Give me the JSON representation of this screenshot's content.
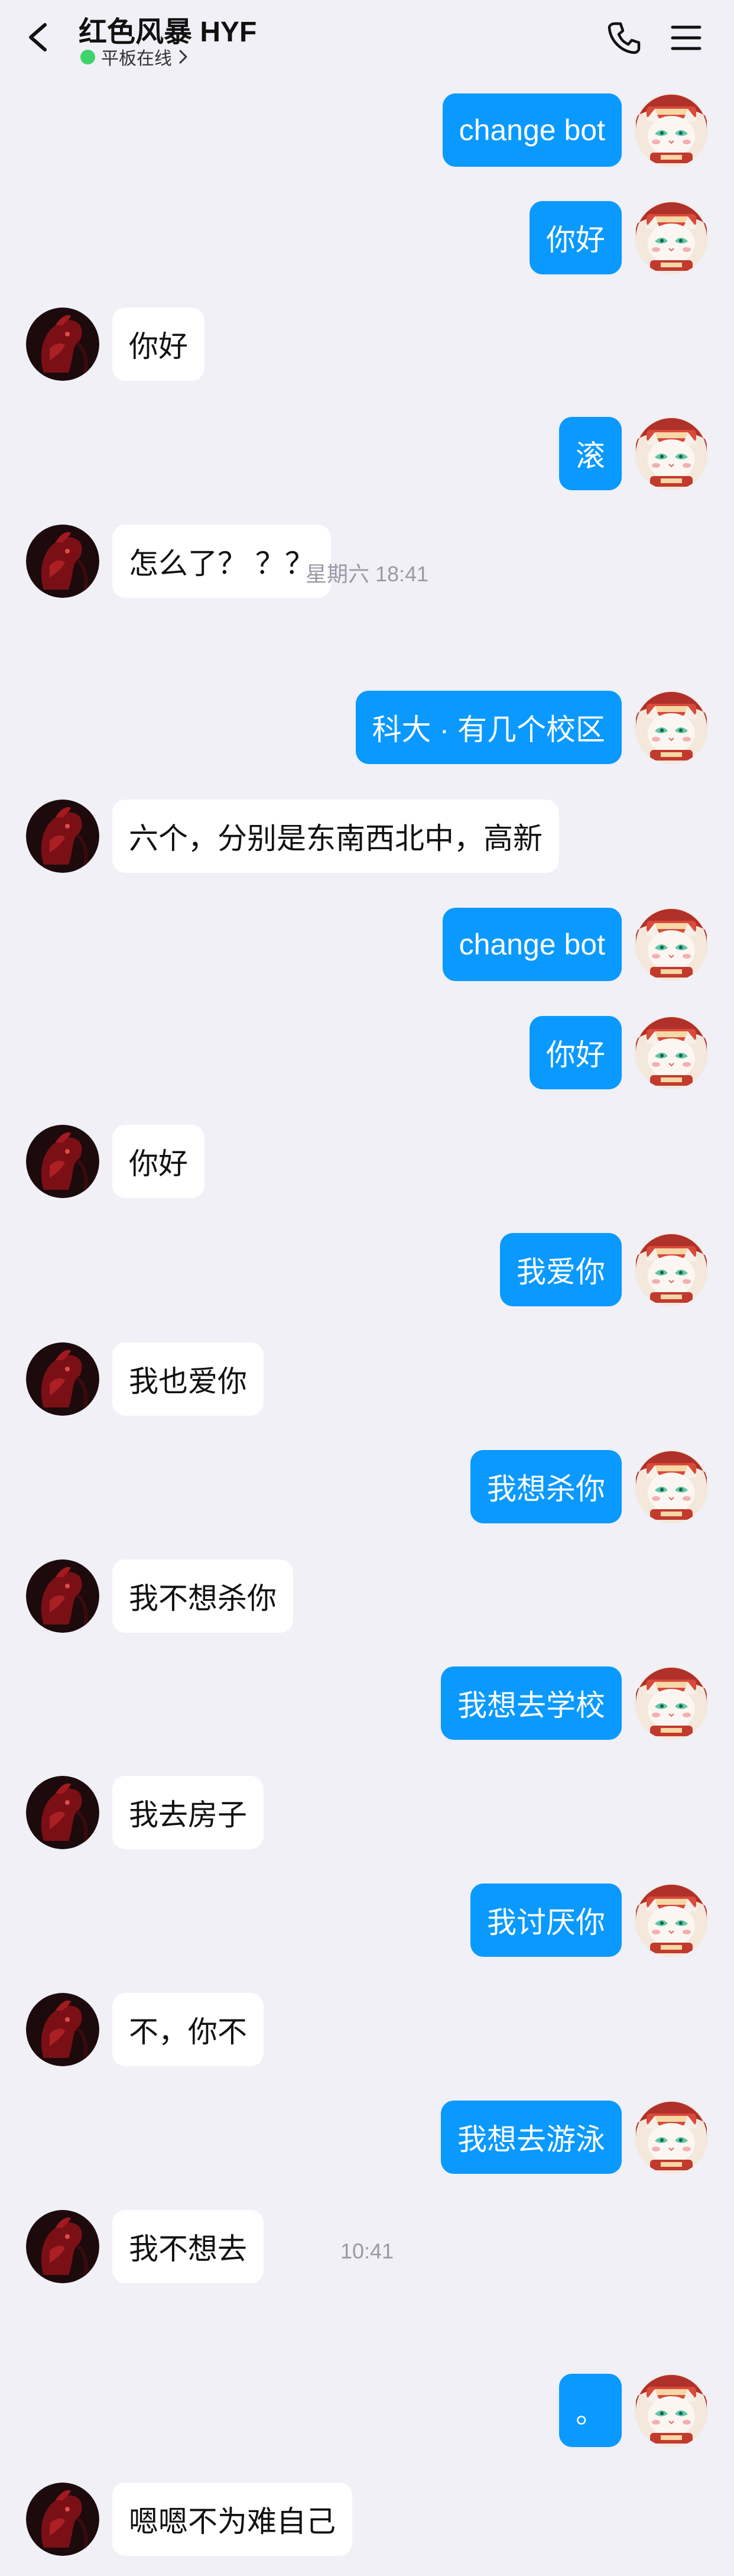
{
  "header": {
    "contact_name": "红色风暴 HYF",
    "status": "平板在线"
  },
  "timestamps": [
    "星期六 18:41",
    "10:41"
  ],
  "messages": [
    {
      "from": "me",
      "text": "change bot"
    },
    {
      "from": "me",
      "text": "你好"
    },
    {
      "from": "other",
      "text": "你好"
    },
    {
      "from": "me",
      "text": "滚"
    },
    {
      "from": "other",
      "text": "怎么了？ ？？"
    },
    {
      "from": "me",
      "text": "科大 · 有几个校区"
    },
    {
      "from": "other",
      "text": "六个，分别是东南西北中，高新"
    },
    {
      "from": "me",
      "text": "change bot"
    },
    {
      "from": "me",
      "text": "你好"
    },
    {
      "from": "other",
      "text": "你好"
    },
    {
      "from": "me",
      "text": "我爱你"
    },
    {
      "from": "other",
      "text": "我也爱你"
    },
    {
      "from": "me",
      "text": "我想杀你"
    },
    {
      "from": "other",
      "text": "我不想杀你"
    },
    {
      "from": "me",
      "text": "我想去学校"
    },
    {
      "from": "other",
      "text": "我去房子"
    },
    {
      "from": "me",
      "text": "我讨厌你"
    },
    {
      "from": "other",
      "text": "不，你不"
    },
    {
      "from": "me",
      "text": "我想去游泳"
    },
    {
      "from": "other",
      "text": "我不想去"
    },
    {
      "from": "me",
      "text": "。"
    },
    {
      "from": "other",
      "text": "嗯嗯不为难自己"
    }
  ],
  "colors": {
    "background": "#f0f0f6",
    "my_bubble": "#0a99ff",
    "other_bubble": "#ffffff",
    "online_dot": "#3fd46b"
  },
  "icons": [
    "back-arrow-icon",
    "phone-icon",
    "menu-icon",
    "chevron-right-icon"
  ]
}
